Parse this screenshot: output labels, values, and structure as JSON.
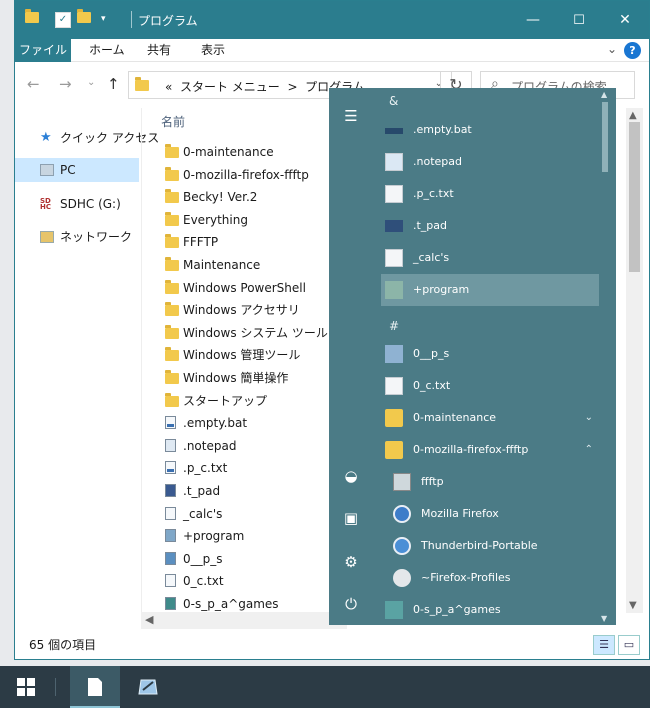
{
  "window": {
    "title": "プログラム",
    "controls": {
      "minimize": "—",
      "maximize": "☐",
      "close": "✕"
    }
  },
  "ribbon": {
    "tabs": [
      "ファイル",
      "ホーム",
      "共有",
      "表示"
    ],
    "help": "?"
  },
  "address": {
    "crumb_prefix": "«",
    "crumbs": [
      "スタート メニュー",
      "プログラム"
    ],
    "separator": ">",
    "search_placeholder": "プログラムの検索"
  },
  "nav": {
    "items": [
      {
        "label": "クイック アクセス",
        "icon": "star-icon"
      },
      {
        "label": "PC",
        "icon": "pc-icon",
        "selected": true
      },
      {
        "label": "SDHC (G:)",
        "icon": "sd-card-icon"
      },
      {
        "label": "ネットワーク",
        "icon": "network-icon"
      }
    ]
  },
  "list": {
    "column_name": "名前",
    "items": [
      {
        "name": "0-maintenance",
        "type": "folder"
      },
      {
        "name": "0-mozilla-firefox-ffftp",
        "type": "folder"
      },
      {
        "name": "Becky! Ver.2",
        "type": "folder"
      },
      {
        "name": "Everything",
        "type": "folder"
      },
      {
        "name": "FFFTP",
        "type": "folder"
      },
      {
        "name": "Maintenance",
        "type": "folder"
      },
      {
        "name": "Windows PowerShell",
        "type": "folder"
      },
      {
        "name": "Windows アクセサリ",
        "type": "folder"
      },
      {
        "name": "Windows システム ツール",
        "type": "folder"
      },
      {
        "name": "Windows 管理ツール",
        "type": "folder"
      },
      {
        "name": "Windows 簡単操作",
        "type": "folder"
      },
      {
        "name": "スタートアップ",
        "type": "folder"
      },
      {
        "name": ".empty.bat",
        "type": "shortcut"
      },
      {
        "name": ".notepad",
        "type": "shortcut"
      },
      {
        "name": ".p_c.txt",
        "type": "shortcut"
      },
      {
        "name": ".t_pad",
        "type": "shortcut"
      },
      {
        "name": "_calc's",
        "type": "shortcut"
      },
      {
        "name": "+program",
        "type": "shortcut"
      },
      {
        "name": "0__p_s",
        "type": "shortcut"
      },
      {
        "name": "0_c.txt",
        "type": "shortcut"
      },
      {
        "name": "0-s_p_a^games",
        "type": "shortcut"
      }
    ]
  },
  "status": {
    "count_text": "65 個の項目"
  },
  "startmenu": {
    "rail": [
      "hamburger-icon",
      "edge-icon",
      "file-explorer-icon",
      "settings-icon",
      "power-icon"
    ],
    "groups": [
      {
        "letter": "&",
        "items": [
          ".empty.bat",
          ".notepad",
          ".p_c.txt",
          ".t_pad",
          "_calc's",
          "+program"
        ]
      },
      {
        "letter": "#",
        "items": [
          "0__p_s",
          "0_c.txt"
        ]
      }
    ],
    "folders": [
      {
        "name": "0-maintenance",
        "expander": "⌄"
      },
      {
        "name": "0-mozilla-firefox-ffftp",
        "expander": "⌃"
      }
    ],
    "subitems": [
      "ffftp",
      "Mozilla Firefox",
      "Thunderbird-Portable",
      "~Firefox-Profiles"
    ],
    "last_item": "0-s_p_a^games",
    "highlighted": "+program"
  },
  "taskbar": {
    "items": [
      "start-button",
      "notepad-app",
      "pen-app"
    ]
  },
  "colors": {
    "accent": "#2b7d8e",
    "startmenu_bg": "#4b7b86",
    "taskbar_bg": "#2c3b45",
    "folder": "#f2c94c"
  }
}
